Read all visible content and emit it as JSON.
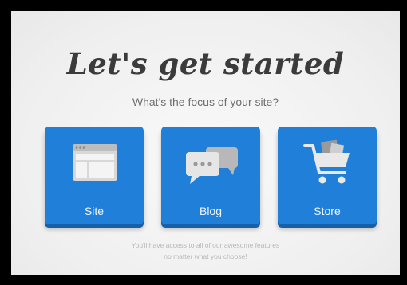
{
  "header": {
    "title": "Let's get started",
    "subtitle": "What's the focus of your site?"
  },
  "options": [
    {
      "label": "Site",
      "icon": "browser-window-icon"
    },
    {
      "label": "Blog",
      "icon": "chat-bubbles-icon"
    },
    {
      "label": "Store",
      "icon": "shopping-cart-icon"
    }
  ],
  "footer": {
    "line1": "You'll have access to all of our awesome features",
    "line2": "no matter what you choose!"
  },
  "colors": {
    "accent": "#1f7fd9",
    "accent_shadow": "#1660a8",
    "title_text": "#3b3b3b"
  }
}
